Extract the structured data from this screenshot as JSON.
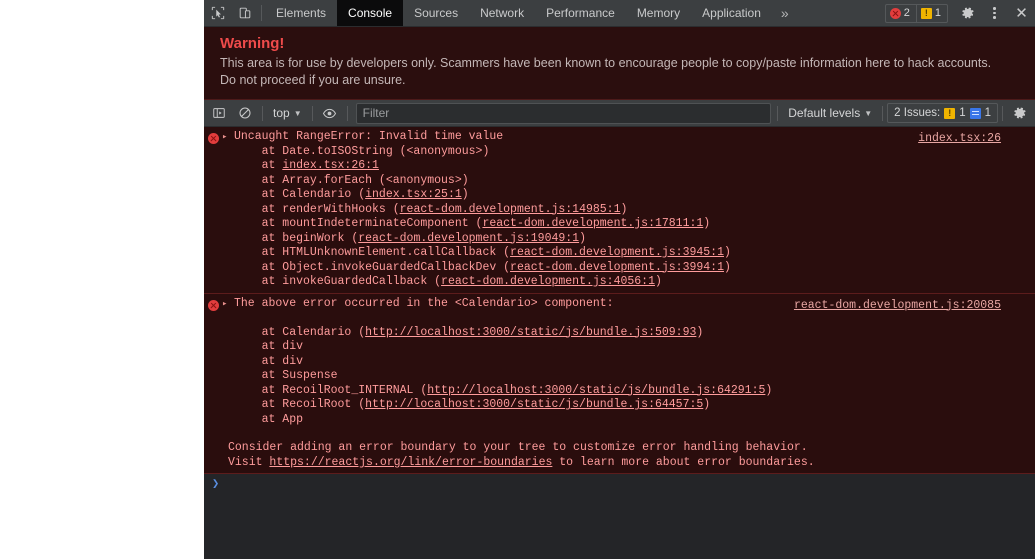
{
  "tabbar": {
    "inspect_icon": "inspect-cursor-icon",
    "device_icon": "device-toolbar-icon",
    "tabs": [
      {
        "label": "Elements",
        "active": false
      },
      {
        "label": "Console",
        "active": true
      },
      {
        "label": "Sources",
        "active": false
      },
      {
        "label": "Network",
        "active": false
      },
      {
        "label": "Performance",
        "active": false
      },
      {
        "label": "Memory",
        "active": false
      },
      {
        "label": "Application",
        "active": false
      }
    ],
    "more_tabs_label": "»",
    "error_count": "2",
    "warning_count": "1",
    "warning_glyph": "!",
    "settings_icon": "gear-icon",
    "menu_icon": "kebab-menu-icon",
    "close_icon": "close-icon",
    "close_glyph": "✕"
  },
  "warning_banner": {
    "title": "Warning!",
    "body": "This area is for use by developers only. Scammers have been known to encourage people to copy/paste information here to hack accounts. Do not proceed if you are unsure."
  },
  "filterbar": {
    "sidebar_toggle_icon": "console-sidebar-icon",
    "clear_icon": "clear-console-icon",
    "context_selected": "top",
    "eye_icon": "live-expression-icon",
    "filter_placeholder": "Filter",
    "filter_value": "",
    "levels_selected": "Default levels",
    "issues_label": "2 Issues:",
    "issues_warning_count": "1",
    "issues_info_count": "1",
    "settings_icon": "console-settings-gear-icon"
  },
  "console": {
    "messages": [
      {
        "id": "msg-1",
        "level": "error",
        "disclosure": "▸",
        "title": "Uncaught RangeError: Invalid time value",
        "source_link": "index.tsx:26",
        "stack": [
          {
            "prefix": "    at Date.toISOString (<anonymous>)",
            "link": "",
            "suffix": ""
          },
          {
            "prefix": "    at ",
            "link": "index.tsx:26:1",
            "suffix": ""
          },
          {
            "prefix": "    at Array.forEach (<anonymous>)",
            "link": "",
            "suffix": ""
          },
          {
            "prefix": "    at Calendario (",
            "link": "index.tsx:25:1",
            "suffix": ")"
          },
          {
            "prefix": "    at renderWithHooks (",
            "link": "react-dom.development.js:14985:1",
            "suffix": ")"
          },
          {
            "prefix": "    at mountIndeterminateComponent (",
            "link": "react-dom.development.js:17811:1",
            "suffix": ")"
          },
          {
            "prefix": "    at beginWork (",
            "link": "react-dom.development.js:19049:1",
            "suffix": ")"
          },
          {
            "prefix": "    at HTMLUnknownElement.callCallback (",
            "link": "react-dom.development.js:3945:1",
            "suffix": ")"
          },
          {
            "prefix": "    at Object.invokeGuardedCallbackDev (",
            "link": "react-dom.development.js:3994:1",
            "suffix": ")"
          },
          {
            "prefix": "    at invokeGuardedCallback (",
            "link": "react-dom.development.js:4056:1",
            "suffix": ")"
          }
        ]
      },
      {
        "id": "msg-2",
        "level": "error",
        "disclosure": "▸",
        "title": "The above error occurred in the <Calendario> component:",
        "source_link": "react-dom.development.js:20085",
        "stack": [
          {
            "prefix": "",
            "link": "",
            "suffix": ""
          },
          {
            "prefix": "    at Calendario (",
            "link": "http://localhost:3000/static/js/bundle.js:509:93",
            "suffix": ")"
          },
          {
            "prefix": "    at div",
            "link": "",
            "suffix": ""
          },
          {
            "prefix": "    at div",
            "link": "",
            "suffix": ""
          },
          {
            "prefix": "    at Suspense",
            "link": "",
            "suffix": ""
          },
          {
            "prefix": "    at RecoilRoot_INTERNAL (",
            "link": "http://localhost:3000/static/js/bundle.js:64291:5",
            "suffix": ")"
          },
          {
            "prefix": "    at RecoilRoot (",
            "link": "http://localhost:3000/static/js/bundle.js:64457:5",
            "suffix": ")"
          },
          {
            "prefix": "    at App",
            "link": "",
            "suffix": ""
          }
        ],
        "notes": [
          {
            "prefix": "Consider adding an error boundary to your tree to customize error handling behavior.",
            "link": "",
            "suffix": ""
          },
          {
            "prefix": "Visit ",
            "link": "https://reactjs.org/link/error-boundaries",
            "suffix": " to learn more about error boundaries."
          }
        ]
      }
    ],
    "prompt_arrow": "❯",
    "prompt_value": ""
  },
  "colors": {
    "error_bg": "#2a0d0d",
    "error_text": "#ff9c9c",
    "toolbar_bg": "#3c3f41",
    "panel_bg": "#242528",
    "warning_title": "#ef4b4b",
    "accent_blue": "#5a8ee0",
    "badge_error": "#e23d3d",
    "badge_warning": "#f0b400",
    "badge_info": "#3a76e8"
  }
}
